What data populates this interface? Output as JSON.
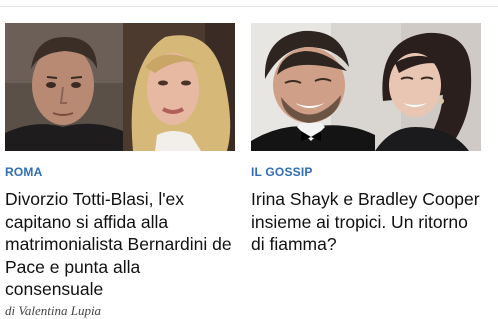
{
  "articles": [
    {
      "category": "ROMA",
      "title": "Divorzio Totti-Blasi, l'ex capitano si affida alla matrimonialista Bernardini de Pace e punta alla consensuale",
      "author": "di Valentina Lupia"
    },
    {
      "category": "IL GOSSIP",
      "title": "Irina Shayk e Bradley Cooper insieme ai tropici. Un ritorno di fiamma?"
    }
  ],
  "colors": {
    "category": "#2f6db5",
    "title": "#111111"
  }
}
